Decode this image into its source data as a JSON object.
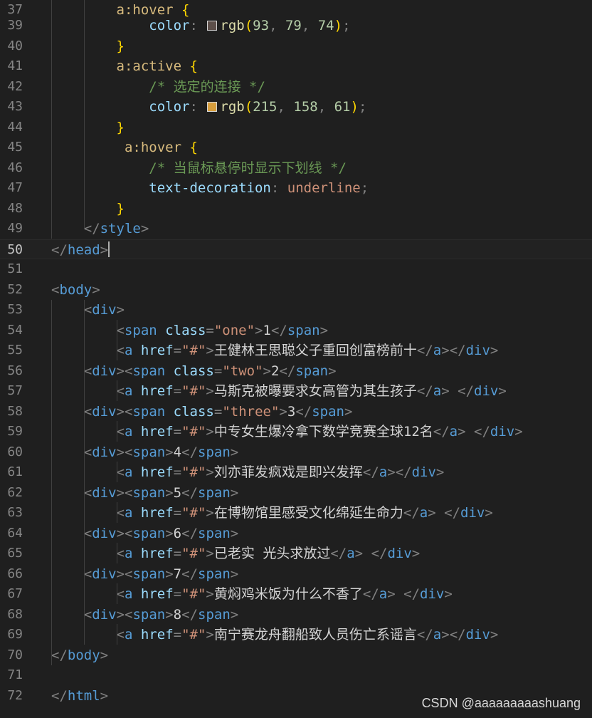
{
  "editor": {
    "active_line": "50",
    "lines": [
      {
        "n": "37"
      },
      {
        "n": "39"
      },
      {
        "n": "40"
      },
      {
        "n": "41"
      },
      {
        "n": "42"
      },
      {
        "n": "43"
      },
      {
        "n": "44"
      },
      {
        "n": "45"
      },
      {
        "n": "46"
      },
      {
        "n": "47"
      },
      {
        "n": "48"
      },
      {
        "n": "49"
      },
      {
        "n": "50"
      },
      {
        "n": "51"
      },
      {
        "n": "52"
      },
      {
        "n": "53"
      },
      {
        "n": "54"
      },
      {
        "n": "55"
      },
      {
        "n": "56"
      },
      {
        "n": "57"
      },
      {
        "n": "58"
      },
      {
        "n": "59"
      },
      {
        "n": "60"
      },
      {
        "n": "61"
      },
      {
        "n": "62"
      },
      {
        "n": "63"
      },
      {
        "n": "64"
      },
      {
        "n": "65"
      },
      {
        "n": "66"
      },
      {
        "n": "67"
      },
      {
        "n": "68"
      },
      {
        "n": "69"
      },
      {
        "n": "70"
      },
      {
        "n": "71"
      },
      {
        "n": "72"
      }
    ],
    "code": {
      "l37_sel": "a:hover",
      "l39_prop": "color",
      "l39_func": "rgb",
      "l39_n1": "93",
      "l39_n2": "79",
      "l39_n3": "74",
      "swatch39": "#5d4f4a",
      "l41_sel": "a:active",
      "l42_comment": "/* 选定的连接 */",
      "l43_prop": "color",
      "l43_func": "rgb",
      "l43_n1": "215",
      "l43_n2": "158",
      "l43_n3": "61",
      "swatch43": "#d79e3d",
      "l45_sel": "a:hover",
      "l46_comment": "/* 当鼠标悬停时显示下划线 */",
      "l47_prop": "text-decoration",
      "l47_value": "underline",
      "style_tag": "style",
      "head_tag": "head",
      "body_tag": "body",
      "div_tag": "div",
      "span_tag": "span",
      "a_tag": "a",
      "html_tag": "html",
      "class_attr": "class",
      "href_attr": "href",
      "href_val": "\"#\"",
      "class_one": "\"one\"",
      "class_two": "\"two\"",
      "class_three": "\"three\"",
      "num1": "1",
      "num2": "2",
      "num3": "3",
      "num4": "4",
      "num5": "5",
      "num6": "6",
      "num7": "7",
      "num8": "8",
      "link1": "王健林王思聪父子重回创富榜前十",
      "link2": "马斯克被曝要求女高管为其生孩子",
      "link3": "中专女生爆冷拿下数学竞赛全球12名",
      "link4": "刘亦菲发疯戏是即兴发挥",
      "link5": "在博物馆里感受文化绵延生命力",
      "link6": "已老实 光头求放过",
      "link7": "黄焖鸡米饭为什么不香了",
      "link8": "南宁赛龙舟翻船致人员伤亡系谣言"
    }
  },
  "watermark": "CSDN @aaaaaaaaashuang"
}
